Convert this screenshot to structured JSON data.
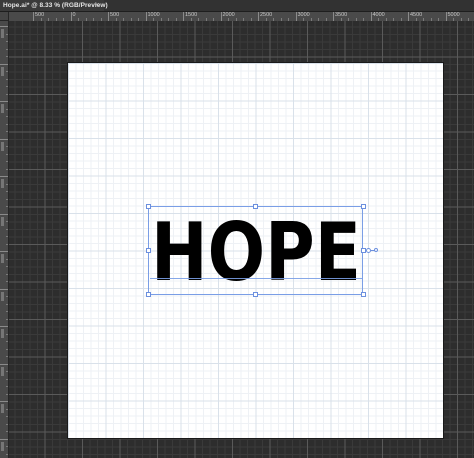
{
  "document": {
    "tab_title": "Hope.ai* @ 8.33 % (RGB/Preview)",
    "close_glyph": "×"
  },
  "ruler": {
    "labels": [
      "500",
      "0",
      "500",
      "1000",
      "1500",
      "2000",
      "2500",
      "3000",
      "3500",
      "4000",
      "4500",
      "5000"
    ]
  },
  "canvas": {
    "text": "HOPE",
    "text_color": "#000000",
    "artboard_color": "#ffffff",
    "pasteboard_color": "#2d2d2d",
    "selection_color": "#6b8fde"
  }
}
